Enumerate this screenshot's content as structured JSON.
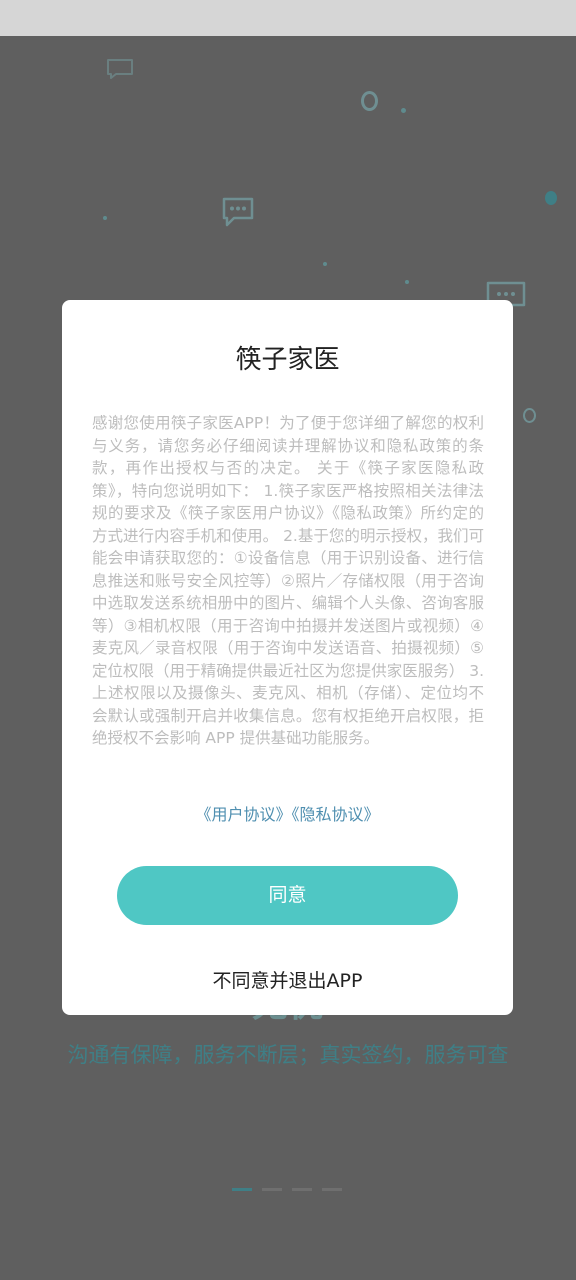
{
  "background": {
    "title": "无忧",
    "subtitle": "沟通有保障，服务不断层；真实签约，服务可查",
    "pager_count": 4,
    "pager_active_index": 0
  },
  "dialog": {
    "title": "筷子家医",
    "body": "感谢您使用筷子家医APP！为了便于您详细了解您的权利与义务，请您务必仔细阅读并理解协议和隐私政策的条款，再作出授权与否的决定。 关于《筷子家医隐私政策》，特向您说明如下： 1.筷子家医严格按照相关法律法规的要求及《筷子家医用户协议》《隐私政策》所约定的方式进行内容手机和使用。 2.基于您的明示授权，我们可能会申请获取您的：①设备信息（用于识别设备、进行信息推送和账号安全风控等）②照片／存储权限（用于咨询中选取发送系统相册中的图片、编辑个人头像、咨询客服等）③相机权限（用于咨询中拍摄并发送图片或视频）④麦克风／录音权限（用于咨询中发送语音、拍摄视频）⑤定位权限（用于精确提供最近社区为您提供家医服务） 3.上述权限以及摄像头、麦克风、相机（存储）、定位均不会默认或强制开启并收集信息。您有权拒绝开启权限，拒绝授权不会影响 APP 提供基础功能服务。",
    "user_agreement_link": "《用户协议》",
    "privacy_agreement_link": "《隐私协议》",
    "agree_label": "同意",
    "decline_label": "不同意并退出APP"
  },
  "colors": {
    "accent": "#4fc7c4",
    "link": "#4f8fb0",
    "overlay": "#5f5f5f"
  }
}
